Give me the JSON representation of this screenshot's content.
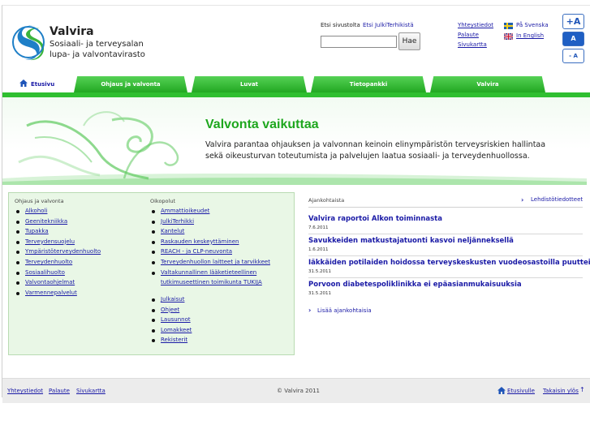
{
  "header": {
    "logo_name": "Valvira",
    "logo_sub1": "Sosiaali- ja terveysalan",
    "logo_sub2": "lupa- ja valvontavirasto",
    "search_label": "Etsi sivustolta",
    "search_extra": "Etsi JulkiTerhikistä",
    "search_input_value": "",
    "search_button": "Hae",
    "links": [
      "Yhteystiedot",
      "Palaute",
      "Sivukartta"
    ],
    "lang_sv": "På Svenska",
    "lang_en": "In English",
    "font_increase": "+A",
    "font_normal": "A",
    "font_decrease": "- A"
  },
  "nav": {
    "home": "Etusivu",
    "tabs": [
      "Ohjaus ja valvonta",
      "Luvat",
      "Tietopankki",
      "Valvira"
    ]
  },
  "hero": {
    "title": "Valvonta vaikuttaa",
    "text": "Valvira parantaa ohjauksen ja valvonnan keinoin elinympäristön terveysriskien hallintaa sekä oikeusturvan toteutumista ja palvelujen laatua sosiaali- ja terveydenhuollossa."
  },
  "links_box": {
    "col1_head": "Ohjaus ja valvonta",
    "col1_items": [
      "Alkoholi",
      "Geenitekniikka",
      "Tupakka",
      "Terveydensuojelu",
      "Ympäristöterveydenhuolto",
      "Terveydenhuolto",
      "Sosiaalihuolto",
      "Valvontaohjelmat",
      "Varmennepalvelut"
    ],
    "col2_head": "Oikopolut",
    "col2_items": [
      "Ammattioikeudet",
      "JulkiTerhikki",
      "Kantelut",
      "Raskauden keskeyttäminen",
      "REACH - ja CLP-neuvonta",
      "Terveydenhuollon laitteet ja tarvikkeet",
      "Valtakunnallinen lääketieteellinen",
      "tutkimuseettinen toimikunta TUKIJA"
    ],
    "col2_items_b": [
      "Julkaisut",
      "Ohjeet",
      "Lausunnot",
      "Lomakkeet",
      "Rekisterit"
    ]
  },
  "news": {
    "heading": "Ajankohtaista",
    "press_link": "Lehdistötiedotteet",
    "items": [
      {
        "title": "Valvira raportoi Alkon toiminnasta",
        "date": "7.6.2011"
      },
      {
        "title": "Savukkeiden matkustajatuonti kasvoi neljänneksellä",
        "date": "1.6.2011"
      },
      {
        "title": "Iäkkäiden potilaiden hoidossa terveyskeskusten vuodeosastoilla puutteita",
        "date": "31.5.2011"
      },
      {
        "title": "Porvoon diabetespoliklinikka ei epäasianmukaisuuksia",
        "date": "31.5.2011"
      }
    ],
    "more_link": "Lisää ajankohtaisia"
  },
  "footer": {
    "links": [
      "Yhteystiedot",
      "Palaute",
      "Sivukartta"
    ],
    "copyright": "© Valvira 2011",
    "home_link": "Etusivulle",
    "top_link": "Takaisin ylös"
  },
  "colors": {
    "accent_green": "#2fbf30",
    "link_blue": "#1a1aa6",
    "hero_title": "#1ea71e"
  }
}
